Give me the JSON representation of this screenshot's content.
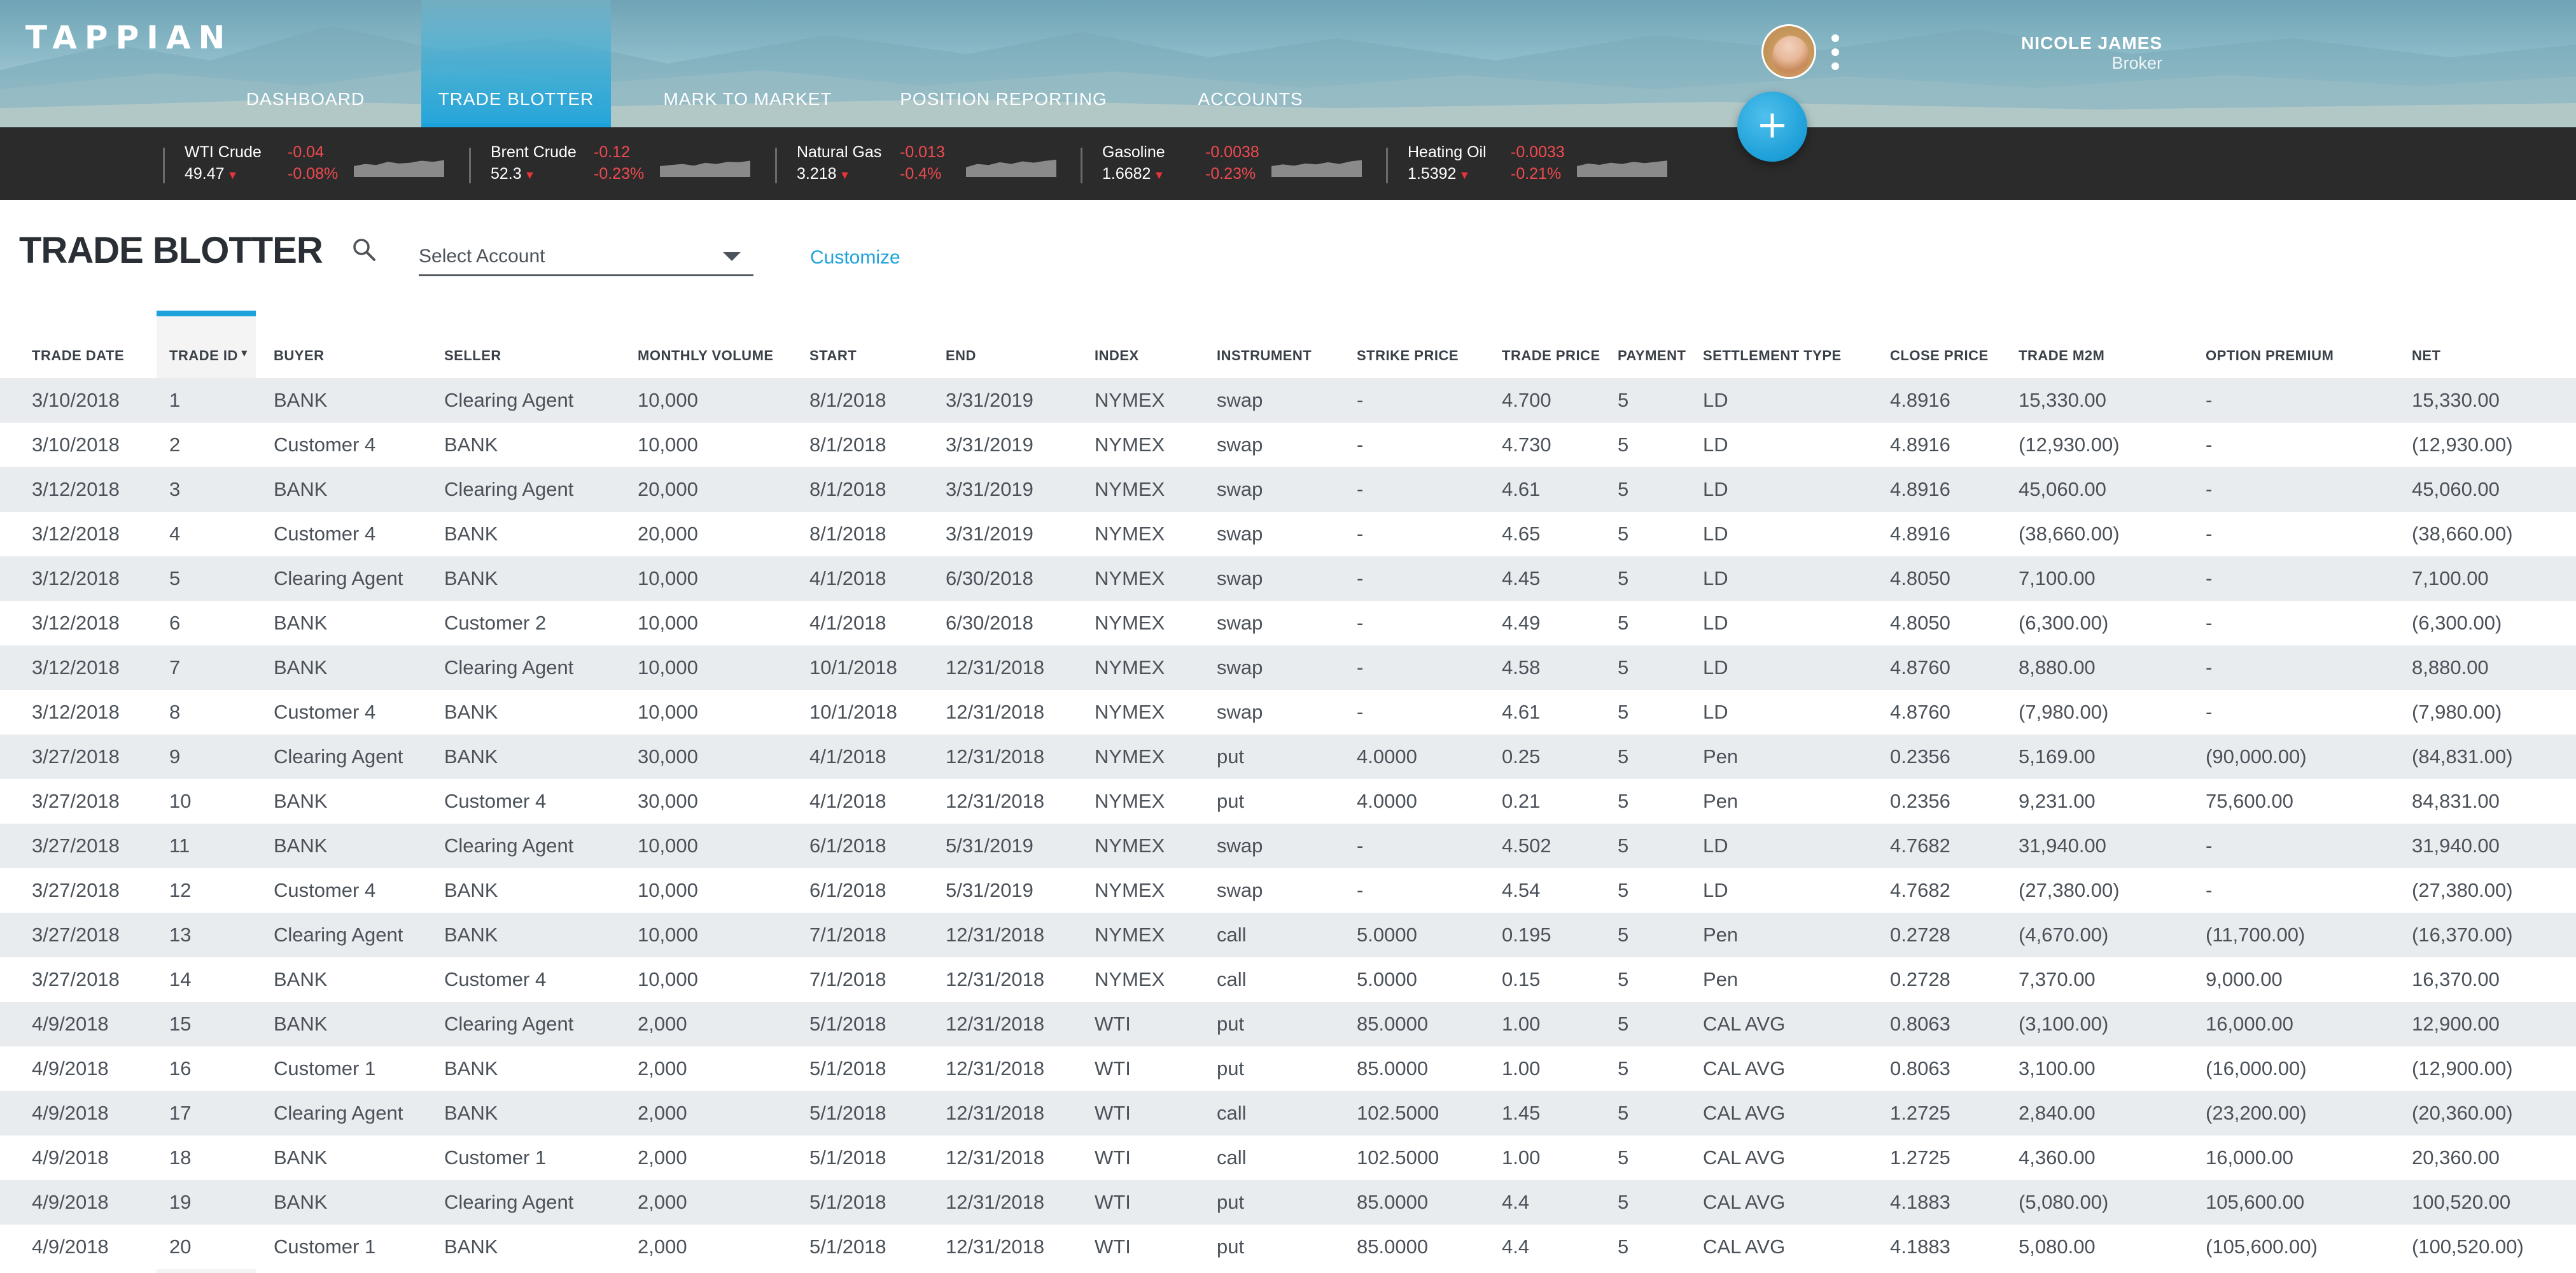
{
  "app": {
    "logo": "TAPPIAN"
  },
  "nav": [
    {
      "label": "DASHBOARD",
      "active": false
    },
    {
      "label": "TRADE BLOTTER",
      "active": true
    },
    {
      "label": "MARK TO MARKET",
      "active": false
    },
    {
      "label": "POSITION REPORTING",
      "active": false
    },
    {
      "label": "ACCOUNTS",
      "active": false
    }
  ],
  "user": {
    "name": "NICOLE JAMES",
    "role": "Broker"
  },
  "fab": {
    "label": "+"
  },
  "ticker": [
    {
      "name": "WTI Crude",
      "price": "49.47",
      "change": "-0.04",
      "percent": "-0.08%",
      "trend": [
        0.5,
        0.6,
        0.55,
        0.7,
        0.62,
        0.66,
        0.75,
        0.7,
        0.78
      ]
    },
    {
      "name": "Brent Crude",
      "price": "52.3",
      "change": "-0.12",
      "percent": "-0.23%",
      "trend": [
        0.5,
        0.55,
        0.6,
        0.52,
        0.65,
        0.6,
        0.7,
        0.68,
        0.75
      ]
    },
    {
      "name": "Natural Gas",
      "price": "3.218",
      "change": "-0.013",
      "percent": "-0.4%",
      "trend": [
        0.45,
        0.6,
        0.55,
        0.68,
        0.6,
        0.72,
        0.66,
        0.74,
        0.8
      ]
    },
    {
      "name": "Gasoline",
      "price": "1.6682",
      "change": "-0.0038",
      "percent": "-0.23%",
      "trend": [
        0.5,
        0.58,
        0.52,
        0.62,
        0.58,
        0.68,
        0.6,
        0.72,
        0.78
      ]
    },
    {
      "name": "Heating Oil",
      "price": "1.5392",
      "change": "-0.0033",
      "percent": "-0.21%",
      "trend": [
        0.5,
        0.62,
        0.56,
        0.66,
        0.6,
        0.7,
        0.64,
        0.7,
        0.76
      ]
    }
  ],
  "toolbar": {
    "title": "TRADE BLOTTER",
    "account_select_label": "Select Account",
    "customize_label": "Customize"
  },
  "table": {
    "sorted_column": "TRADE ID",
    "sort_indicator": "▼",
    "columns": [
      "TRADE DATE",
      "TRADE ID",
      "BUYER",
      "SELLER",
      "MONTHLY VOLUME",
      "START",
      "END",
      "INDEX",
      "INSTRUMENT",
      "STRIKE PRICE",
      "TRADE PRICE",
      "PAYMENT",
      "SETTLEMENT TYPE",
      "CLOSE PRICE",
      "TRADE M2M",
      "OPTION PREMIUM",
      "NET"
    ],
    "rows": [
      [
        "3/10/2018",
        "1",
        "BANK",
        "Clearing Agent",
        "10,000",
        "8/1/2018",
        "3/31/2019",
        "NYMEX",
        "swap",
        "-",
        "4.700",
        "5",
        "LD",
        "4.8916",
        "15,330.00",
        "-",
        "15,330.00"
      ],
      [
        "3/10/2018",
        "2",
        "Customer 4",
        "BANK",
        "10,000",
        "8/1/2018",
        "3/31/2019",
        "NYMEX",
        "swap",
        "-",
        "4.730",
        "5",
        "LD",
        "4.8916",
        "(12,930.00)",
        "-",
        "(12,930.00)"
      ],
      [
        "3/12/2018",
        "3",
        "BANK",
        "Clearing Agent",
        "20,000",
        "8/1/2018",
        "3/31/2019",
        "NYMEX",
        "swap",
        "-",
        "4.61",
        "5",
        "LD",
        "4.8916",
        "45,060.00",
        "-",
        "45,060.00"
      ],
      [
        "3/12/2018",
        "4",
        "Customer 4",
        "BANK",
        "20,000",
        "8/1/2018",
        "3/31/2019",
        "NYMEX",
        "swap",
        "-",
        "4.65",
        "5",
        "LD",
        "4.8916",
        "(38,660.00)",
        "-",
        "(38,660.00)"
      ],
      [
        "3/12/2018",
        "5",
        "Clearing Agent",
        "BANK",
        "10,000",
        "4/1/2018",
        "6/30/2018",
        "NYMEX",
        "swap",
        "-",
        "4.45",
        "5",
        "LD",
        "4.8050",
        "7,100.00",
        "-",
        "7,100.00"
      ],
      [
        "3/12/2018",
        "6",
        "BANK",
        "Customer 2",
        "10,000",
        "4/1/2018",
        "6/30/2018",
        "NYMEX",
        "swap",
        "-",
        "4.49",
        "5",
        "LD",
        "4.8050",
        "(6,300.00)",
        "-",
        "(6,300.00)"
      ],
      [
        "3/12/2018",
        "7",
        "BANK",
        "Clearing Agent",
        "10,000",
        "10/1/2018",
        "12/31/2018",
        "NYMEX",
        "swap",
        "-",
        "4.58",
        "5",
        "LD",
        "4.8760",
        "8,880.00",
        "-",
        "8,880.00"
      ],
      [
        "3/12/2018",
        "8",
        "Customer 4",
        "BANK",
        "10,000",
        "10/1/2018",
        "12/31/2018",
        "NYMEX",
        "swap",
        "-",
        "4.61",
        "5",
        "LD",
        "4.8760",
        "(7,980.00)",
        "-",
        "(7,980.00)"
      ],
      [
        "3/27/2018",
        "9",
        "Clearing Agent",
        "BANK",
        "30,000",
        "4/1/2018",
        "12/31/2018",
        "NYMEX",
        "put",
        "4.0000",
        "0.25",
        "5",
        "Pen",
        "0.2356",
        "5,169.00",
        "(90,000.00)",
        "(84,831.00)"
      ],
      [
        "3/27/2018",
        "10",
        "BANK",
        "Customer 4",
        "30,000",
        "4/1/2018",
        "12/31/2018",
        "NYMEX",
        "put",
        "4.0000",
        "0.21",
        "5",
        "Pen",
        "0.2356",
        "9,231.00",
        "75,600.00",
        "84,831.00"
      ],
      [
        "3/27/2018",
        "11",
        "BANK",
        "Clearing Agent",
        "10,000",
        "6/1/2018",
        "5/31/2019",
        "NYMEX",
        "swap",
        "-",
        "4.502",
        "5",
        "LD",
        "4.7682",
        "31,940.00",
        "-",
        "31,940.00"
      ],
      [
        "3/27/2018",
        "12",
        "Customer 4",
        "BANK",
        "10,000",
        "6/1/2018",
        "5/31/2019",
        "NYMEX",
        "swap",
        "-",
        "4.54",
        "5",
        "LD",
        "4.7682",
        "(27,380.00)",
        "-",
        "(27,380.00)"
      ],
      [
        "3/27/2018",
        "13",
        "Clearing Agent",
        "BANK",
        "10,000",
        "7/1/2018",
        "12/31/2018",
        "NYMEX",
        "call",
        "5.0000",
        "0.195",
        "5",
        "Pen",
        "0.2728",
        "(4,670.00)",
        "(11,700.00)",
        "(16,370.00)"
      ],
      [
        "3/27/2018",
        "14",
        "BANK",
        "Customer 4",
        "10,000",
        "7/1/2018",
        "12/31/2018",
        "NYMEX",
        "call",
        "5.0000",
        "0.15",
        "5",
        "Pen",
        "0.2728",
        "7,370.00",
        "9,000.00",
        "16,370.00"
      ],
      [
        "4/9/2018",
        "15",
        "BANK",
        "Clearing Agent",
        "2,000",
        "5/1/2018",
        "12/31/2018",
        "WTI",
        "put",
        "85.0000",
        "1.00",
        "5",
        "CAL AVG",
        "0.8063",
        "(3,100.00)",
        "16,000.00",
        "12,900.00"
      ],
      [
        "4/9/2018",
        "16",
        "Customer 1",
        "BANK",
        "2,000",
        "5/1/2018",
        "12/31/2018",
        "WTI",
        "put",
        "85.0000",
        "1.00",
        "5",
        "CAL AVG",
        "0.8063",
        "3,100.00",
        "(16,000.00)",
        "(12,900.00)"
      ],
      [
        "4/9/2018",
        "17",
        "Clearing Agent",
        "BANK",
        "2,000",
        "5/1/2018",
        "12/31/2018",
        "WTI",
        "call",
        "102.5000",
        "1.45",
        "5",
        "CAL AVG",
        "1.2725",
        "2,840.00",
        "(23,200.00)",
        "(20,360.00)"
      ],
      [
        "4/9/2018",
        "18",
        "BANK",
        "Customer 1",
        "2,000",
        "5/1/2018",
        "12/31/2018",
        "WTI",
        "call",
        "102.5000",
        "1.00",
        "5",
        "CAL AVG",
        "1.2725",
        "4,360.00",
        "16,000.00",
        "20,360.00"
      ],
      [
        "4/9/2018",
        "19",
        "BANK",
        "Clearing Agent",
        "2,000",
        "5/1/2018",
        "12/31/2018",
        "WTI",
        "put",
        "85.0000",
        "4.4",
        "5",
        "CAL AVG",
        "4.1883",
        "(5,080.00)",
        "105,600.00",
        "100,520.00"
      ],
      [
        "4/9/2018",
        "20",
        "Customer 1",
        "BANK",
        "2,000",
        "5/1/2018",
        "12/31/2018",
        "WTI",
        "put",
        "85.0000",
        "4.4",
        "5",
        "CAL AVG",
        "4.1883",
        "5,080.00",
        "(105,600.00)",
        "(100,520.00)"
      ]
    ]
  },
  "colors": {
    "accent": "#1ea2dc",
    "ticker_bg": "#2b2b2b",
    "negative": "#f04a4f",
    "row_alt": "#e9ecef"
  },
  "icons": {
    "search": "search-icon",
    "dropdown": "chevron-down-icon",
    "more": "more-vertical-icon",
    "trend_down": "triangle-down-icon"
  }
}
